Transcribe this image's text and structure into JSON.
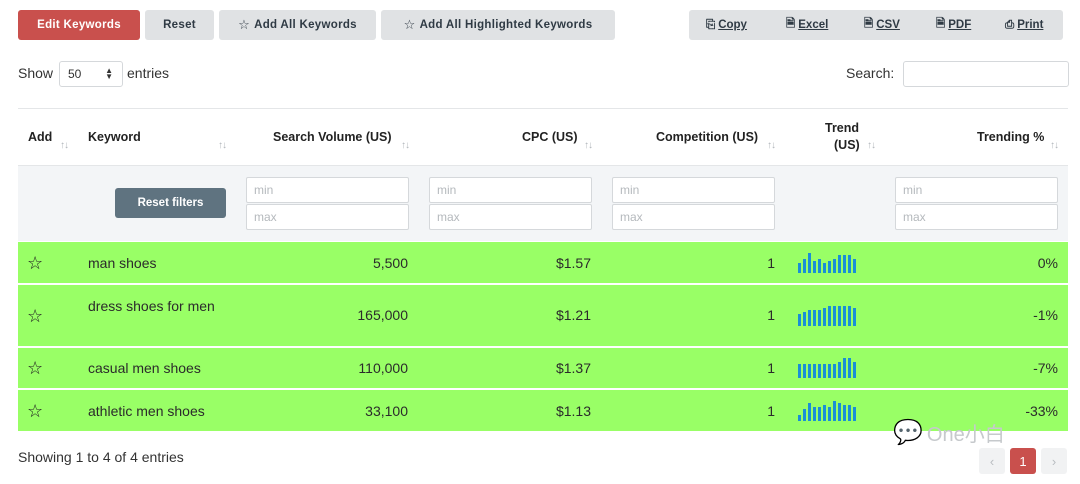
{
  "toolbar": {
    "edit_keywords": "Edit Keywords",
    "reset": "Reset",
    "add_all": "Add All Keywords",
    "add_highlighted": "Add All Highlighted Keywords",
    "export": {
      "copy": "Copy",
      "excel": "Excel",
      "csv": "CSV",
      "pdf": "PDF",
      "print": "Print"
    }
  },
  "controls": {
    "show_label": "Show",
    "entries_value": "50",
    "entries_label": "entries",
    "search_label": "Search:",
    "search_value": ""
  },
  "table": {
    "headers": {
      "add": "Add",
      "keyword": "Keyword",
      "volume": "Search Volume (US)",
      "cpc": "CPC (US)",
      "competition": "Competition (US)",
      "trend_line1": "Trend",
      "trend_line2": "(US)",
      "trending": "Trending %"
    },
    "filters": {
      "reset_filters": "Reset filters",
      "min_placeholder": "min",
      "max_placeholder": "max"
    },
    "highlight_color": "#99ff66",
    "rows": [
      {
        "keyword": "man shoes",
        "volume": "5,500",
        "cpc": "$1.57",
        "competition": "1",
        "trending": "0%",
        "trend": [
          0.5,
          0.7,
          1.0,
          0.6,
          0.7,
          0.5,
          0.6,
          0.7,
          0.9,
          0.9,
          0.9,
          0.7
        ]
      },
      {
        "keyword": "dress shoes for men",
        "volume": "165,000",
        "cpc": "$1.21",
        "competition": "1",
        "trending": "-1%",
        "trend": [
          0.6,
          0.7,
          0.8,
          0.8,
          0.8,
          0.9,
          1.0,
          1.0,
          1.0,
          1.0,
          1.0,
          0.9
        ]
      },
      {
        "keyword": "casual men shoes",
        "volume": "110,000",
        "cpc": "$1.37",
        "competition": "1",
        "trending": "-7%",
        "trend": [
          0.7,
          0.7,
          0.7,
          0.7,
          0.7,
          0.7,
          0.7,
          0.7,
          0.8,
          1.0,
          1.0,
          0.8
        ]
      },
      {
        "keyword": "athletic men shoes",
        "volume": "33,100",
        "cpc": "$1.13",
        "competition": "1",
        "trending": "-33%",
        "trend": [
          0.3,
          0.6,
          0.9,
          0.7,
          0.7,
          0.8,
          0.7,
          1.0,
          0.9,
          0.8,
          0.8,
          0.7
        ]
      }
    ]
  },
  "footer": {
    "info": "Showing 1 to 4 of 4 entries",
    "prev": "‹",
    "current_page": "1",
    "next": "›"
  },
  "watermark": "One小白"
}
